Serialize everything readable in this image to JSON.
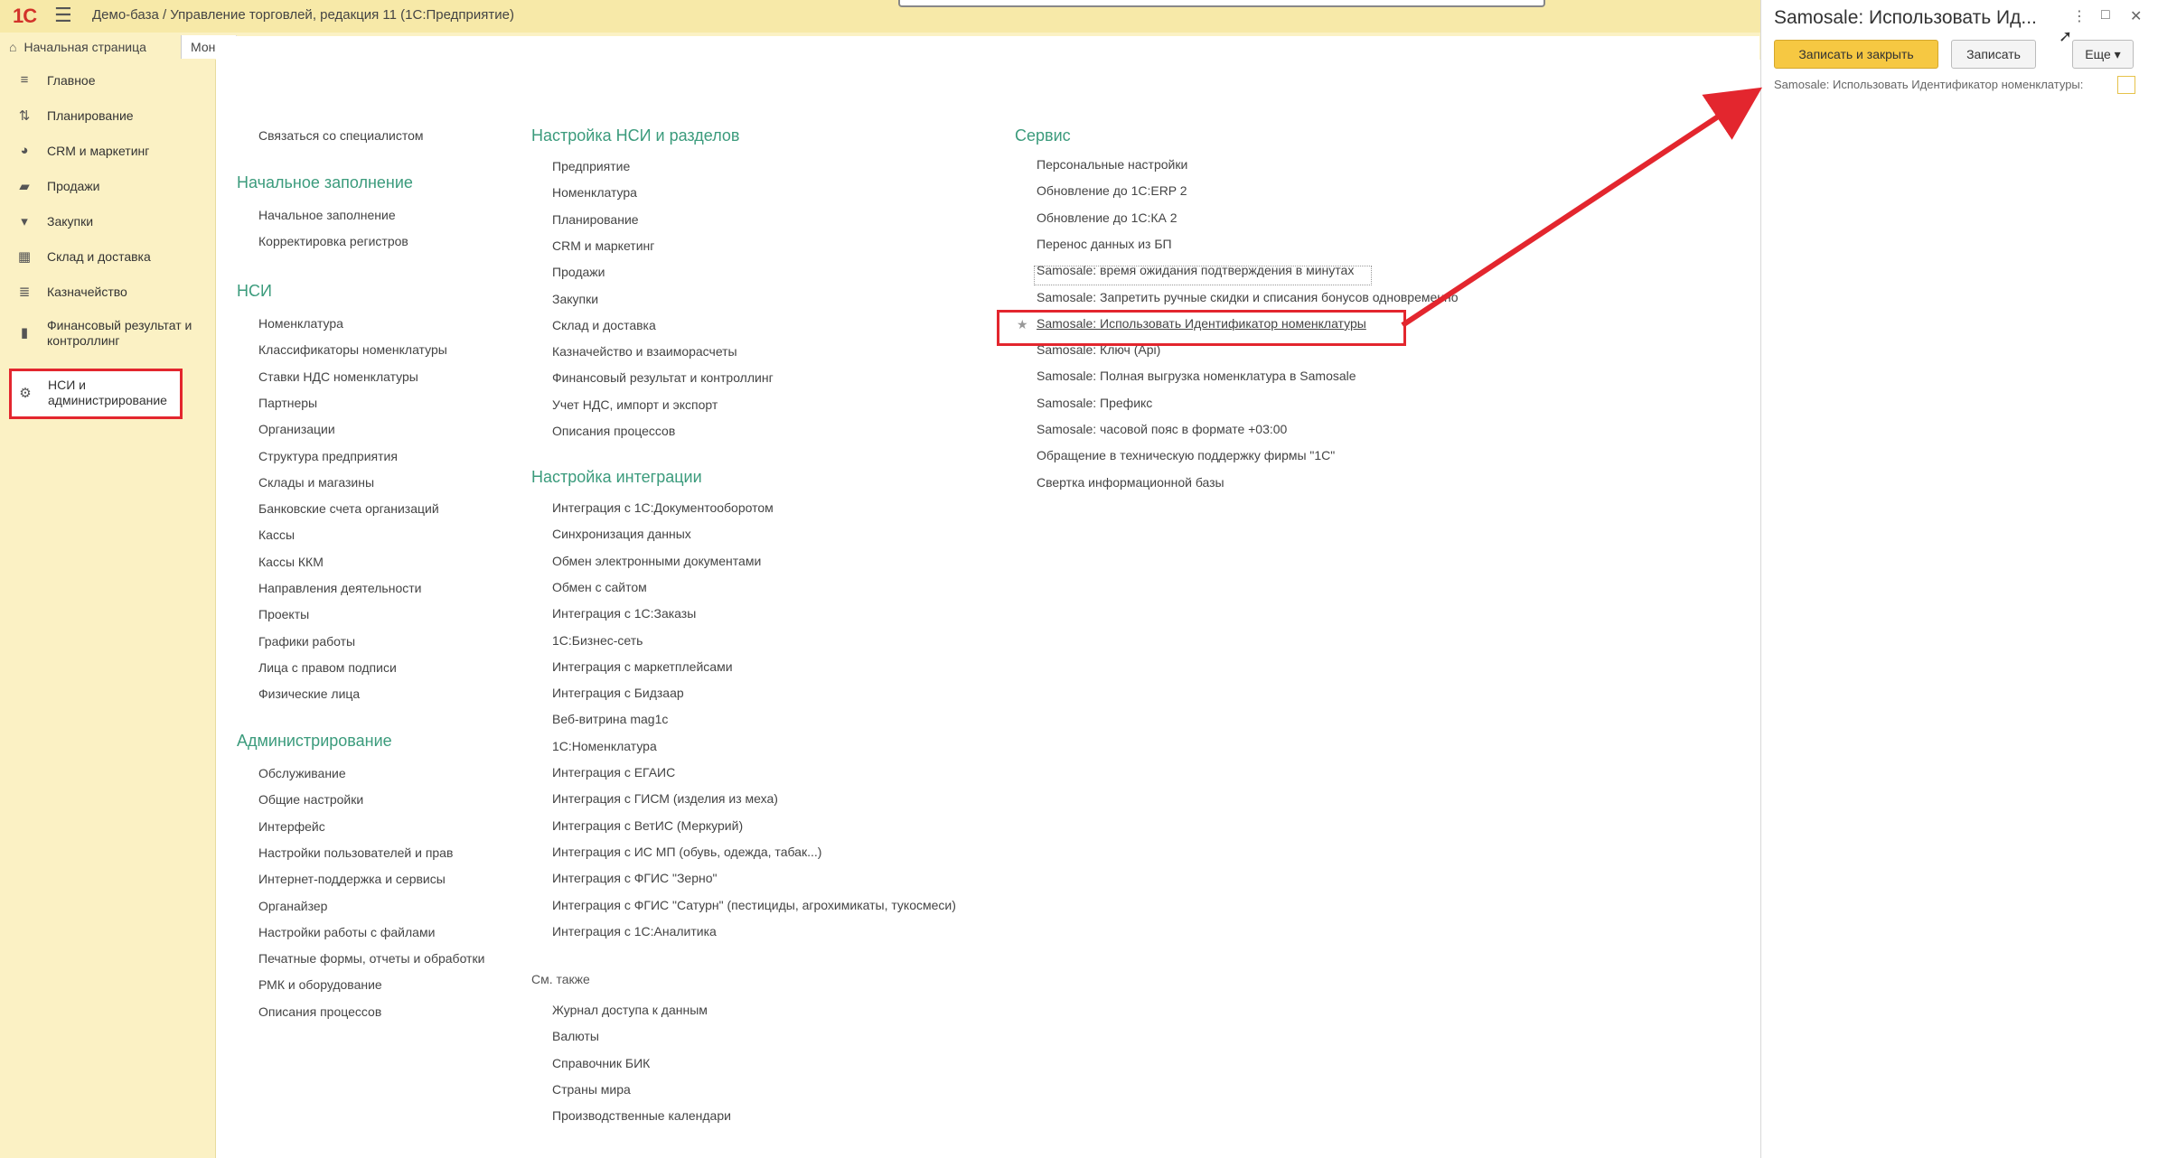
{
  "window": {
    "logo": "1С",
    "title": "Демо-база / Управление торговлей, редакция 11  (1С:Предприятие)"
  },
  "tabs": [
    {
      "label": "Начальная страница",
      "icon": "home-icon"
    },
    {
      "label": "Мон"
    }
  ],
  "sidebar": {
    "items": [
      {
        "label": "Главное",
        "icon": "menu-lines-icon"
      },
      {
        "label": "Планирование",
        "icon": "planning-icon"
      },
      {
        "label": "CRM и маркетинг",
        "icon": "pie-icon"
      },
      {
        "label": "Продажи",
        "icon": "bag-icon"
      },
      {
        "label": "Закупки",
        "icon": "cart-icon"
      },
      {
        "label": "Склад и доставка",
        "icon": "warehouse-icon"
      },
      {
        "label": "Казначейство",
        "icon": "treasury-icon"
      },
      {
        "label": "Финансовый результат и контроллинг",
        "icon": "bar-chart-icon"
      },
      {
        "label": "НСИ и администрирование",
        "icon": "gear-icon"
      }
    ]
  },
  "col1": {
    "contact": "Связаться со специалистом",
    "sections": [
      {
        "title": "Начальное заполнение",
        "items": [
          "Начальное заполнение",
          "Корректировка регистров"
        ]
      },
      {
        "title": "НСИ",
        "items": [
          "Номенклатура",
          "Классификаторы номенклатуры",
          "Ставки НДС номенклатуры",
          "Партнеры",
          "Организации",
          "Структура предприятия",
          "Склады и магазины",
          "Банковские счета организаций",
          "Кассы",
          "Кассы ККМ",
          "Направления деятельности",
          "Проекты",
          "Графики работы",
          "Лица с правом подписи",
          "Физические лица"
        ]
      },
      {
        "title": "Администрирование",
        "items": [
          "Обслуживание",
          "Общие настройки",
          "Интерфейс",
          "Настройки пользователей и прав",
          "Интернет-поддержка и сервисы",
          "Органайзер",
          "Настройки работы с файлами",
          "Печатные формы, отчеты и обработки",
          "РМК и оборудование",
          "Описания процессов"
        ]
      }
    ]
  },
  "col2": {
    "sections": [
      {
        "title": "Настройка НСИ и разделов",
        "items": [
          "Предприятие",
          "Номенклатура",
          "Планирование",
          "CRM и маркетинг",
          "Продажи",
          "Закупки",
          "Склад и доставка",
          "Казначейство и взаиморасчеты",
          "Финансовый результат и контроллинг",
          "Учет НДС, импорт и экспорт",
          "Описания процессов"
        ]
      },
      {
        "title": "Настройка интеграции",
        "items": [
          "Интеграция с 1С:Документооборотом",
          "Синхронизация данных",
          "Обмен электронными документами",
          "Обмен с сайтом",
          "Интеграция с 1С:Заказы",
          "1С:Бизнес-сеть",
          "Интеграция с маркетплейсами",
          "Интеграция с Бидзаар",
          "Веб-витрина mag1c",
          "1С:Номенклатура",
          "Интеграция с ЕГАИС",
          "Интеграция с ГИСМ (изделия из меха)",
          "Интеграция с ВетИС (Меркурий)",
          "Интеграция с ИС МП (обувь, одежда, табак...)",
          "Интеграция с ФГИС \"Зерно\"",
          "Интеграция с ФГИС \"Сатурн\" (пестициды, агрохимикаты, тукосмеси)",
          "Интеграция с 1С:Аналитика"
        ]
      }
    ],
    "see_also": {
      "title": "См. также",
      "items": [
        "Журнал доступа к данным",
        "Валюты",
        "Справочник БИК",
        "Страны мира",
        "Производственные календари"
      ]
    }
  },
  "col3": {
    "title": "Сервис",
    "items": [
      "Персональные настройки",
      "Обновление до 1С:ERP 2",
      "Обновление до 1С:КА 2",
      "Перенос данных из БП",
      "Samosale: время ожидания подтверждения в минутах",
      "Samosale: Запретить ручные скидки и списания бонусов одновременно",
      "Samosale: Использовать Идентификатор номенклатуры",
      "Samosale: Ключ (Api)",
      "Samosale: Полная выгрузка номенклатура в Samosale",
      "Samosale: Префикс",
      "Samosale: часовой пояс в формате +03:00",
      "Обращение в техническую поддержку фирмы \"1С\"",
      "Свертка информационной базы"
    ],
    "star": "★"
  },
  "panel": {
    "title": "Samosale: Использовать Ид...",
    "btn_save_close": "Записать и закрыть",
    "btn_save": "Записать",
    "btn_more": "Еще ▾",
    "field_label": "Samosale: Использовать Идентификатор номенклатуры:",
    "checkbox_checked": false,
    "controls": {
      "menu": "⋮",
      "maximize": "□",
      "close": "✕"
    }
  },
  "colors": {
    "accent_header": "#3b9b7c",
    "highlight_red": "#e3262e",
    "button_yellow": "#f6c842",
    "sidebar_bg": "#fbf1c4",
    "topbar_bg": "#f7e9a8"
  }
}
